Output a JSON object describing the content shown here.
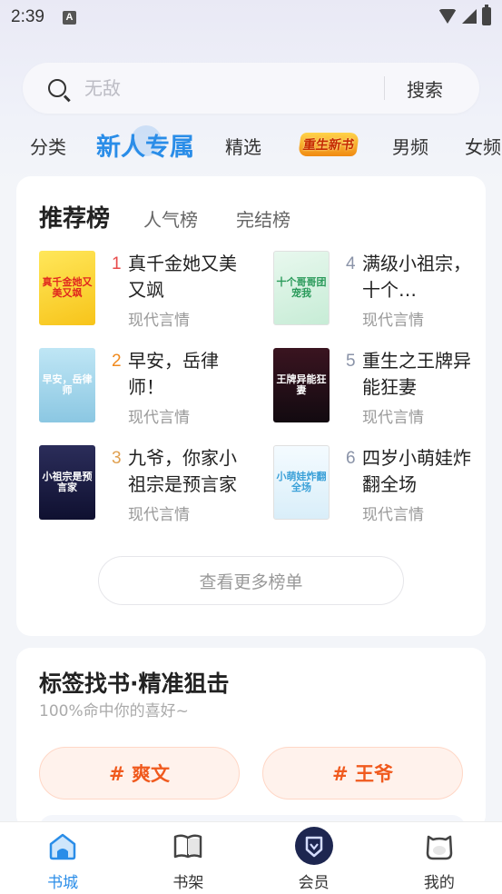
{
  "status_bar": {
    "time": "2:39",
    "notification_glyph": "A"
  },
  "search": {
    "placeholder": "无敌",
    "button_label": "搜索"
  },
  "nav_tabs": [
    {
      "label": "分类"
    },
    {
      "label": "新人专属",
      "active": true
    },
    {
      "label": "精选"
    },
    {
      "label": "重生新书",
      "badge": true
    },
    {
      "label": "男频"
    },
    {
      "label": "女频"
    }
  ],
  "ranking": {
    "tabs": [
      "推荐榜",
      "人气榜",
      "完结榜"
    ],
    "books": [
      {
        "rank": "1",
        "title": "真千金她又美又飒",
        "genre": "现代言情",
        "cover_text": "真千金她又美又飒",
        "rank_color": "#e84a4a"
      },
      {
        "rank": "2",
        "title": "早安，岳律师！",
        "genre": "现代言情",
        "cover_text": "早安，岳律师",
        "rank_color": "#f08a1e"
      },
      {
        "rank": "3",
        "title": "九爷，你家小祖宗是预言家",
        "genre": "现代言情",
        "cover_text": "小祖宗是预言家",
        "rank_color": "#e0a050"
      },
      {
        "rank": "4",
        "title": "满级小祖宗，十个…",
        "genre": "现代言情",
        "cover_text": "十个哥哥团宠我",
        "rank_color": "#8a93a8"
      },
      {
        "rank": "5",
        "title": "重生之王牌异能狂妻",
        "genre": "现代言情",
        "cover_text": "王牌异能狂妻",
        "rank_color": "#8a93a8"
      },
      {
        "rank": "6",
        "title": "四岁小萌娃炸翻全场",
        "genre": "现代言情",
        "cover_text": "小萌娃炸翻全场",
        "rank_color": "#8a93a8"
      }
    ],
    "more_label": "查看更多榜单"
  },
  "tags": {
    "title": "标签找书·精准狙击",
    "subtitle": "100%命中你的喜好~",
    "items": [
      "# 爽文",
      "# 王爷"
    ]
  },
  "bottom_nav": [
    {
      "label": "书城",
      "icon": "home-icon",
      "active": true
    },
    {
      "label": "书架",
      "icon": "book-icon"
    },
    {
      "label": "会员",
      "icon": "vip-shield-icon"
    },
    {
      "label": "我的",
      "icon": "profile-icon"
    }
  ],
  "colors": {
    "accent": "#2a8de8",
    "tag_text": "#f05a1e",
    "tag_bg": "#fff2ec"
  }
}
